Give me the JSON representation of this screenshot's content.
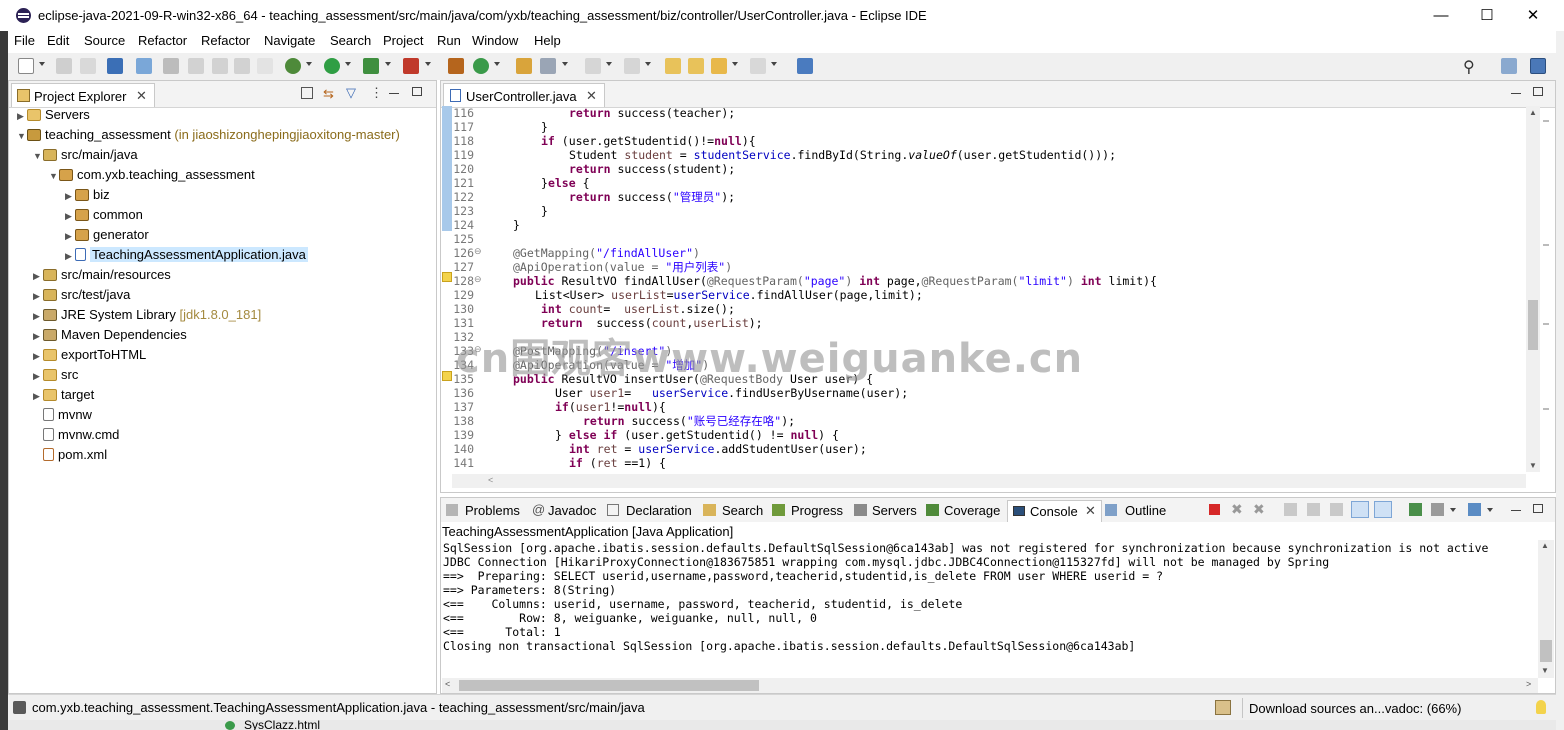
{
  "window": {
    "title": "eclipse-java-2021-09-R-win32-x86_64 - teaching_assessment/src/main/java/com/yxb/teaching_assessment/biz/controller/UserController.java - Eclipse IDE",
    "minimize": "—",
    "maximize": "☐",
    "close": "✕"
  },
  "menu": [
    "File",
    "Edit",
    "Source",
    "Refactor",
    "Refactor",
    "Navigate",
    "Search",
    "Project",
    "Run",
    "Window",
    "Help"
  ],
  "explorer": {
    "tab": "Project Explorer",
    "items": [
      {
        "label": "Servers",
        "deco": ""
      },
      {
        "label": "teaching_assessment",
        "deco": "(in jiaoshizonghepingjiaoxitong-master)"
      },
      {
        "label": "src/main/java",
        "deco": ""
      },
      {
        "label": "com.yxb.teaching_assessment",
        "deco": ""
      },
      {
        "label": "biz",
        "deco": ""
      },
      {
        "label": "common",
        "deco": ""
      },
      {
        "label": "generator",
        "deco": ""
      },
      {
        "label": "TeachingAssessmentApplication.java",
        "deco": ""
      },
      {
        "label": "src/main/resources",
        "deco": ""
      },
      {
        "label": "src/test/java",
        "deco": ""
      },
      {
        "label": "JRE System Library",
        "deco": "[jdk1.8.0_181]"
      },
      {
        "label": "Maven Dependencies",
        "deco": ""
      },
      {
        "label": "exportToHTML",
        "deco": ""
      },
      {
        "label": "src",
        "deco": ""
      },
      {
        "label": "target",
        "deco": ""
      },
      {
        "label": "mvnw",
        "deco": ""
      },
      {
        "label": "mvnw.cmd",
        "deco": ""
      },
      {
        "label": "pom.xml",
        "deco": ""
      }
    ]
  },
  "editor": {
    "tab": "UserController.java",
    "line_numbers": [
      "116",
      "117",
      "118",
      "119",
      "120",
      "121",
      "122",
      "123",
      "124",
      "125",
      "126",
      "127",
      "128",
      "129",
      "130",
      "131",
      "132",
      "133",
      "134",
      "135",
      "136",
      "137",
      "138",
      "139",
      "140",
      "141"
    ],
    "s": {
      "return": "return",
      "if": "if",
      "null": "null",
      "else": "else",
      "public": "public",
      "int": "int",
      "success_teacher": " success(teacher);",
      "l117": "}",
      "l118b": " (user.getStudentid()!=",
      "l118c": "){",
      "l119a": "Student ",
      "l119b": "student",
      "l119c": " = ",
      "l119d": "studentService",
      "l119e": ".findById(String.",
      "l119f": "valueOf",
      "l119g": "(user.getStudentid()));",
      "l120b": " success(student);",
      "l121a": "}",
      "l121c": " {",
      "l122b": " success(",
      "l122s": "\"管理员\"",
      "l122c": ");",
      "l123": "}",
      "l124": "}",
      "l126a": "@GetMapping(",
      "l126s": "\"/findAllUser\"",
      "l126c": ")",
      "l127a": "@ApiOperation(value = ",
      "l127s": "\"用户列表\"",
      "l127c": ")",
      "l128b": " ResultVO findAllUser(",
      "l128c": "@RequestParam(",
      "l128s1": "\"page\"",
      "l128d": ") ",
      "l128e": " page,",
      "l128f": "@RequestParam(",
      "l128s2": "\"limit\"",
      "l128g": ") ",
      "l128h": " limit){",
      "l129a": "List<User> ",
      "l129b": "userList",
      "l129c": "=",
      "l129d": "userService",
      "l129e": ".findAllUser(page,limit);",
      "l130b": " ",
      "l130c": "count",
      "l130d": "=  ",
      "l130e": "userList",
      "l130f": ".size();",
      "l131b": "  success(",
      "l131c": "count",
      "l131d": ",",
      "l131e": "userList",
      "l131f": ");",
      "l133a": "@PostMapping(",
      "l133s": "\"/insert\"",
      "l133c": ")",
      "l134a": "@ApiOperation(value = ",
      "l134s": "\"增加\"",
      "l134c": ")",
      "l135b": " ResultVO insertUser(",
      "l135c": "@RequestBody",
      "l135d": " User user) {",
      "l136a": "User ",
      "l136b": "user1",
      "l136c": "=   ",
      "l136d": "userService",
      "l136e": ".findUserByUsername(user);",
      "l137b": "(",
      "l137c": "user1",
      "l137d": "!=",
      "l137f": "){",
      "l138b": " success(",
      "l138s": "\"账号已经存在咯\"",
      "l138c": ");",
      "l139a": "} ",
      "l139c": " ",
      "l139e": " (user.getStudentid() != ",
      "l139g": ") {",
      "l140b": " ",
      "l140c": "ret",
      "l140d": " = ",
      "l140e": "userService",
      "l140f": ".addStudentUser(user);",
      "l141b": " (",
      "l141c": "ret",
      "l141d": " ==1) {"
    }
  },
  "bottom": {
    "tabs": [
      "Problems",
      "Javadoc",
      "Declaration",
      "Search",
      "Progress",
      "Servers",
      "Coverage",
      "Console",
      "Outline"
    ],
    "console_title": "TeachingAssessmentApplication [Java Application]",
    "console_lines": [
      "SqlSession [org.apache.ibatis.session.defaults.DefaultSqlSession@6ca143ab] was not registered for synchronization because synchronization is not active",
      "JDBC Connection [HikariProxyConnection@183675851 wrapping com.mysql.jdbc.JDBC4Connection@115327fd] will not be managed by Spring",
      "==>  Preparing: SELECT userid,username,password,teacherid,studentid,is_delete FROM user WHERE userid = ?",
      "==> Parameters: 8(String)",
      "<==    Columns: userid, username, password, teacherid, studentid, is_delete",
      "<==        Row: 8, weiguanke, weiguanke, null, null, 0",
      "<==      Total: 1",
      "Closing non transactional SqlSession [org.apache.ibatis.session.defaults.DefaultSqlSession@6ca143ab]"
    ]
  },
  "statusbar": {
    "selection": "com.yxb.teaching_assessment.TeachingAssessmentApplication.java - teaching_assessment/src/main/java",
    "progress": "Download sources an...vadoc: (66%)"
  },
  "taskbar_peek": "SysClazz.html",
  "watermark": "cn围观客www.weiguanke.cn"
}
